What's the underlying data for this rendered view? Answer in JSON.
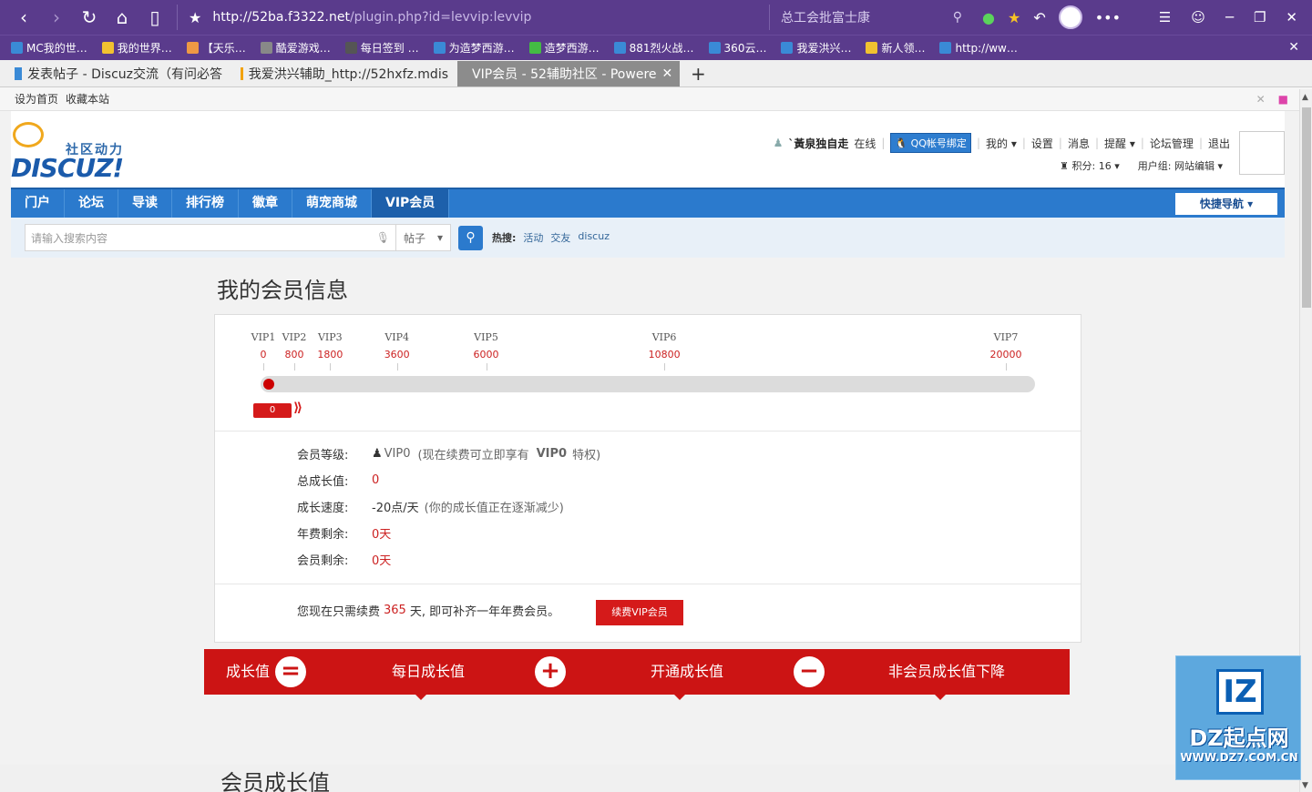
{
  "browser": {
    "url_main": "http://52ba.f3322.net",
    "url_rest": "/plugin.php?id=levvip:levvip",
    "search_text": "总工会批富士康",
    "win_minimize": "─",
    "win_restore": "❐",
    "win_close": "✕",
    "bookmarks": [
      "MC我的世…",
      "我的世界…",
      "【天乐…",
      "酷爱游戏…",
      "每日签到 …",
      "为造梦西游…",
      "造梦西游…",
      "881烈火战…",
      "360云…",
      "我爱洪兴…",
      "新人领…",
      "http://ww…"
    ],
    "tabs": [
      {
        "label": "发表帖子 - Discuz交流（有问必答"
      },
      {
        "label": "我爱洪兴辅助_http://52hxfz.mdis"
      },
      {
        "label": "VIP会员 - 52辅助社区 - Powere"
      }
    ],
    "new_tab": "+"
  },
  "topbar": {
    "set_home": "设为首页",
    "bookmark_site": "收藏本站"
  },
  "logo": {
    "small": "社区动力",
    "big": "DISCUZ!"
  },
  "user": {
    "name": "`黃泉独自走",
    "status": "在线",
    "qq_bind": "QQ帐号绑定",
    "my": "我的",
    "settings": "设置",
    "messages": "消息",
    "reminders": "提醒",
    "forum_admin": "论坛管理",
    "logout": "退出",
    "points_label": "积分: 16",
    "group_label": "用户组: 网站编辑"
  },
  "nav": {
    "items": [
      "门户",
      "论坛",
      "导读",
      "排行榜",
      "徽章",
      "萌宠商城",
      "VIP会员"
    ],
    "quick": "快捷导航"
  },
  "search": {
    "placeholder": "请输入搜索内容",
    "type": "帖子",
    "hot_label": "热搜:",
    "hot_items": [
      "活动",
      "交友",
      "discuz"
    ]
  },
  "member_info": {
    "title": "我的会员信息",
    "levels": [
      {
        "name": "VIP1",
        "value": "0"
      },
      {
        "name": "VIP2",
        "value": "800"
      },
      {
        "name": "VIP3",
        "value": "1800"
      },
      {
        "name": "VIP4",
        "value": "3600"
      },
      {
        "name": "VIP5",
        "value": "6000"
      },
      {
        "name": "VIP6",
        "value": "10800"
      },
      {
        "name": "VIP7",
        "value": "20000"
      }
    ],
    "current_value": "0",
    "level_label": "会员等级:",
    "level_value": "VIP0",
    "level_note": "(现在续费可立即享有",
    "level_note_vip": "VIP0",
    "level_note_end": "特权)",
    "total_label": "总成长值:",
    "total_value": "0",
    "speed_label": "成长速度:",
    "speed_value": "-20点/天",
    "speed_note": "(你的成长值正在逐渐减少)",
    "annual_label": "年费剩余:",
    "annual_value": "0天",
    "member_label": "会员剩余:",
    "member_value": "0天",
    "renew_prefix": "您现在只需续费",
    "renew_days": "365",
    "renew_suffix": "天, 即可补齐一年年费会员。",
    "renew_button": "续费VIP会员"
  },
  "growth": {
    "title": "会员成长值",
    "items": [
      "成长值",
      "每日成长值",
      "开通成长值",
      "非会员成长值下降"
    ],
    "ops": [
      "=",
      "+",
      "−"
    ]
  },
  "watermark": {
    "box": "IZ",
    "text": "DZ起点网",
    "url": "WWW.DZ7.COM.CN"
  }
}
